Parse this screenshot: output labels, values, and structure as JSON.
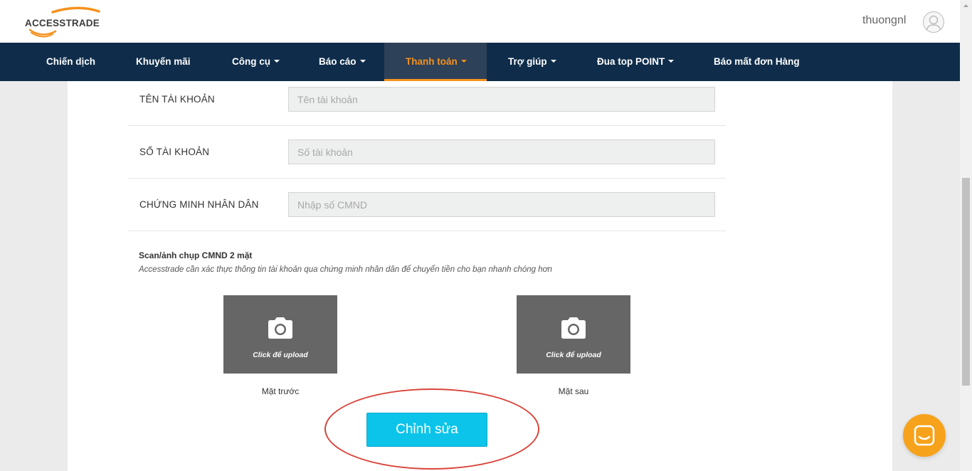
{
  "header": {
    "logo_text": "ACCESSTRADE",
    "username": "thuongnl"
  },
  "nav": {
    "items": [
      {
        "label": "Chiến dịch",
        "dropdown": false,
        "active": false
      },
      {
        "label": "Khuyến mãi",
        "dropdown": false,
        "active": false
      },
      {
        "label": "Công cụ",
        "dropdown": true,
        "active": false
      },
      {
        "label": "Báo cáo",
        "dropdown": true,
        "active": false
      },
      {
        "label": "Thanh toán",
        "dropdown": true,
        "active": true
      },
      {
        "label": "Trợ giúp",
        "dropdown": true,
        "active": false
      },
      {
        "label": "Đua top POINT",
        "dropdown": true,
        "active": false
      },
      {
        "label": "Báo mất đơn Hàng",
        "dropdown": false,
        "active": false
      }
    ],
    "active_color": "#f5921e",
    "background": "#0f2d4b"
  },
  "form": {
    "account_name": {
      "label": "TÊN TÀI KHOẢN",
      "value": "",
      "placeholder": "Tên tài khoản"
    },
    "account_number": {
      "label": "SỐ TÀI KHOẢN",
      "value": "",
      "placeholder": "Số tài khoản"
    },
    "id_card": {
      "label": "CHỨNG MINH NHÂN DÂN",
      "value": "",
      "placeholder": "Nhập số CMND"
    }
  },
  "scan": {
    "title": "Scan/ảnh chụp CMND 2 mặt",
    "description": "Accesstrade cần xác thực thông tin tài khoản qua chứng minh nhân dân để chuyển tiền cho bạn nhanh chóng hơn",
    "front": {
      "upload_text": "Click để upload",
      "caption": "Mặt trước"
    },
    "back": {
      "upload_text": "Click để upload",
      "caption": "Mặt sau"
    }
  },
  "actions": {
    "edit_label": "Chỉnh sửa",
    "edit_color": "#0cc4ea",
    "highlight_color": "#d9443a"
  },
  "icons": {
    "upload": "camera-icon",
    "chat": "chat-icon",
    "avatar": "user-avatar-icon"
  }
}
